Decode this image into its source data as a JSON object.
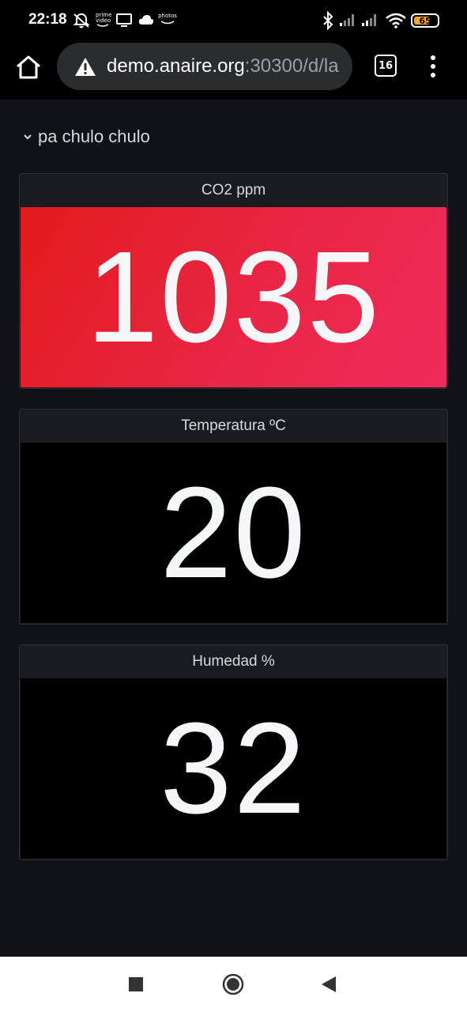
{
  "status_bar": {
    "time": "22:18",
    "prime_video_text": "prime video",
    "photos_text": "photos",
    "battery": "65",
    "icons": [
      "mute-icon",
      "prime-video-icon",
      "tv-icon",
      "cloud-icon",
      "photos-icon",
      "bluetooth-icon",
      "signal-icon",
      "signal-icon",
      "wifi-icon",
      "battery-icon"
    ]
  },
  "browser": {
    "url_host": "demo.anaire.org",
    "url_path": ":30300/d/la",
    "tab_count": "16",
    "icons": [
      "home-icon",
      "warning-icon",
      "tabs-icon",
      "more-vert-icon"
    ]
  },
  "dashboard": {
    "row_title": "pa chulo chulo",
    "panels": [
      {
        "title": "CO2 ppm",
        "value": "1035",
        "color": "#e8233a"
      },
      {
        "title": "Temperatura ºC",
        "value": "20",
        "color": "#000000"
      },
      {
        "title": "Humedad %",
        "value": "32",
        "color": "#000000"
      }
    ]
  },
  "nav_bar": {
    "icons": [
      "recents-icon",
      "home-circle-icon",
      "back-icon"
    ]
  }
}
